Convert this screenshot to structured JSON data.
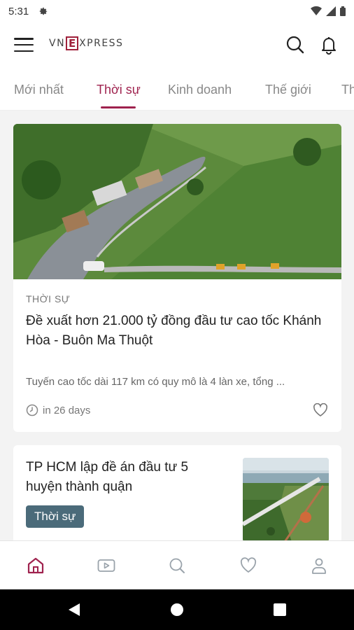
{
  "status_bar": {
    "time": "5:31"
  },
  "app_bar": {
    "logo_left": "VN",
    "logo_mark": "E",
    "logo_right": "XPRESS"
  },
  "tabs": [
    {
      "label": "Mới nhất",
      "active": false
    },
    {
      "label": "Thời sự",
      "active": true
    },
    {
      "label": "Kinh doanh",
      "active": false
    },
    {
      "label": "Thế giới",
      "active": false
    },
    {
      "label": "Th",
      "active": false
    }
  ],
  "feed": {
    "article1": {
      "category": "THỜI SỰ",
      "headline": "Đề xuất hơn 21.000 tỷ đồng đầu tư cao tốc Khánh Hòa - Buôn Ma Thuột",
      "summary": "Tuyến cao tốc dài 117 km có quy mô là 4 làn xe, tổng ...",
      "time": "in 26 days"
    },
    "article2": {
      "headline": "TP HCM lập đề án đầu tư 5 huyện thành quận",
      "tag": "Thời sự"
    }
  },
  "colors": {
    "brand": "#9f224e",
    "tag_bg": "#4b6b7a"
  },
  "bottom_nav": [
    "home-icon",
    "video-icon",
    "search-icon",
    "heart-icon",
    "profile-icon"
  ]
}
